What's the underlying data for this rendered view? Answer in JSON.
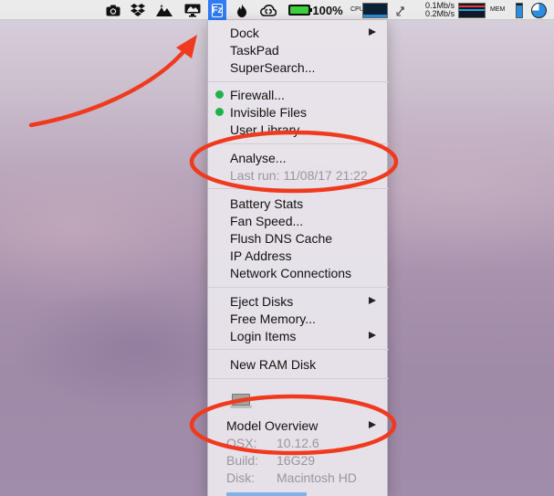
{
  "menubar": {
    "icons": [
      "camera-icon",
      "dropbox-icon",
      "mountain-icon",
      "display-icon",
      "fz-app-icon",
      "flame-icon",
      "creative-cloud-icon"
    ],
    "fz_glyph": "Fz",
    "battery_percent": "100%",
    "battery_level": 1.0,
    "cpu_label": "CPU",
    "net_up": "0.1Mb/s",
    "net_down": "0.2Mb/s",
    "mem_label": "MEM",
    "colors": {
      "selected": "#2f7cf6",
      "battery_fill": "#3cd23c",
      "graph_blue": "#2a8cd8",
      "graph_red": "#e33333"
    }
  },
  "menu": {
    "items": {
      "dock": "Dock",
      "taskpad": "TaskPad",
      "supersearch": "SuperSearch...",
      "firewall": "Firewall...",
      "invisible_files": "Invisible Files",
      "user_library": "User Library",
      "analyse": "Analyse...",
      "last_run": "Last run: 11/08/17 21:22",
      "battery_stats": "Battery Stats",
      "fan_speed": "Fan Speed...",
      "flush_dns": "Flush DNS Cache",
      "ip_address": "IP Address",
      "network_connections": "Network Connections",
      "eject_disks": "Eject Disks",
      "free_memory": "Free Memory...",
      "login_items": "Login Items",
      "new_ram_disk": "New RAM Disk",
      "model_overview": "Model Overview"
    },
    "info": [
      {
        "key": "OSX:",
        "value": "10.12.6"
      },
      {
        "key": "Build:",
        "value": "16G29"
      },
      {
        "key": "Disk:",
        "value": "Macintosh HD"
      }
    ],
    "status_dot_color": "#1fb24a"
  },
  "annotation": {
    "color": "#f03a1f"
  }
}
